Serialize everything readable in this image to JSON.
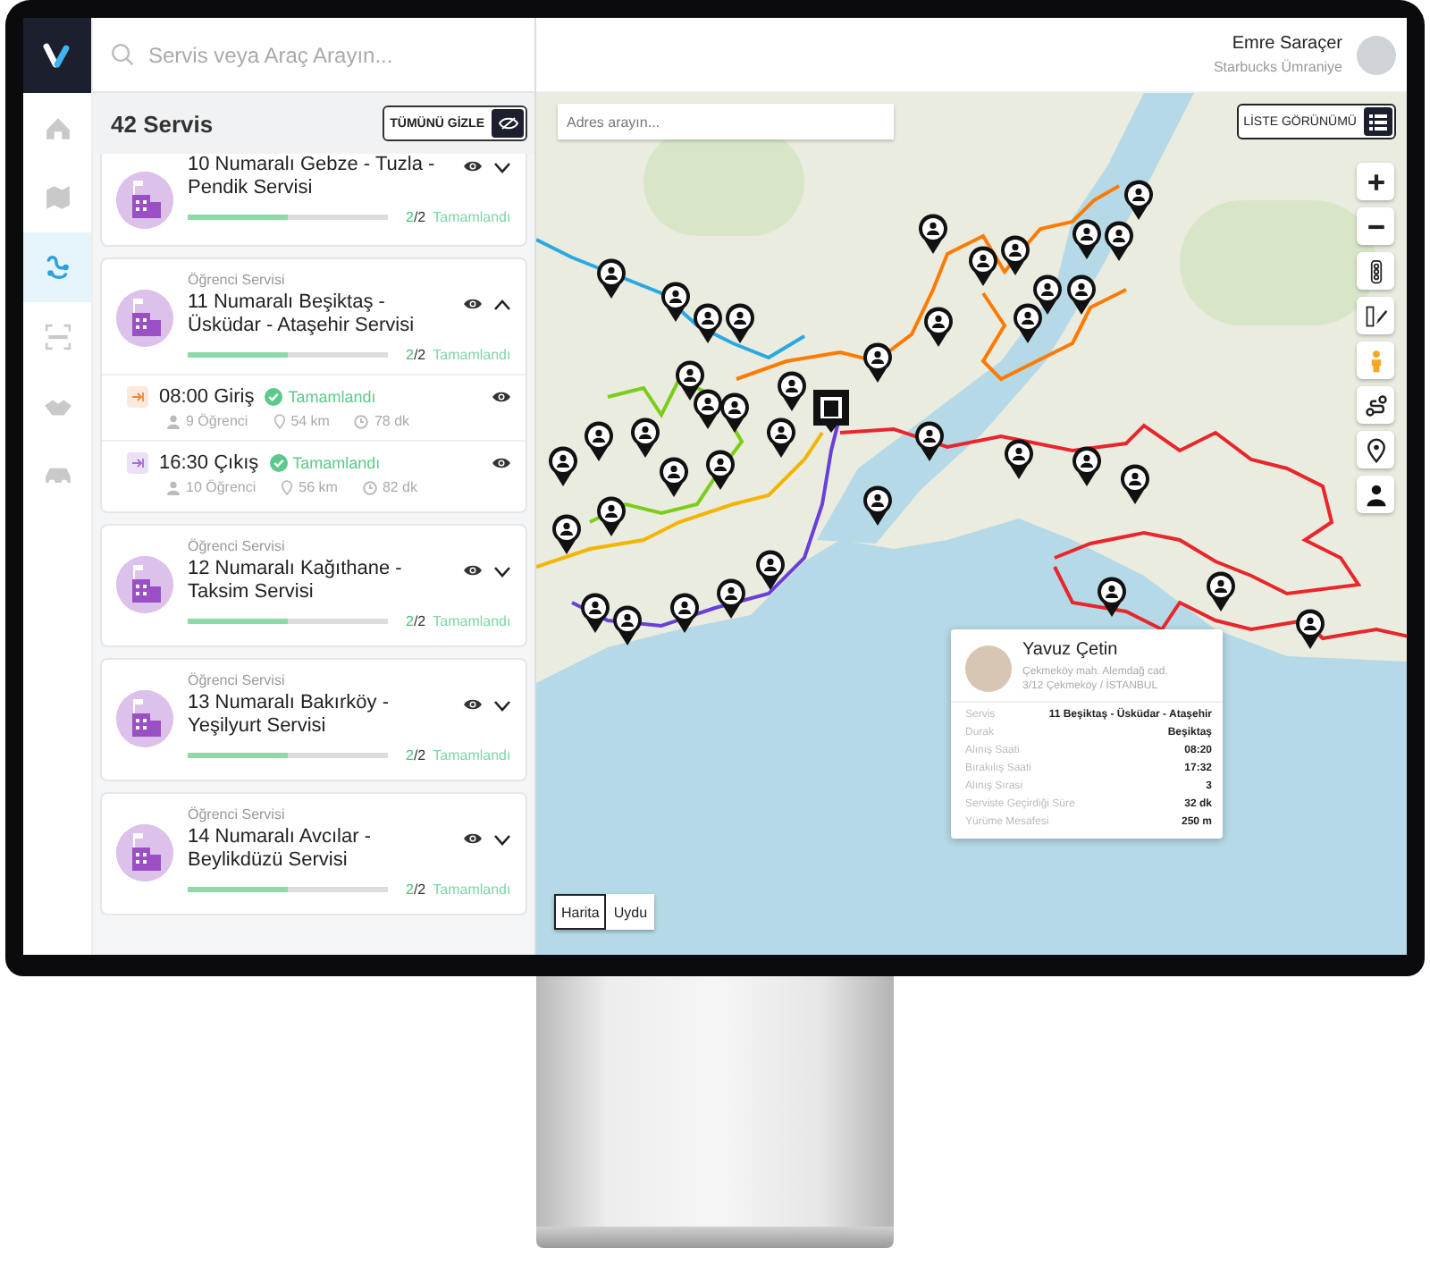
{
  "search": {
    "placeholder": "Servis veya Araç Arayın..."
  },
  "nav": [
    {
      "selected": false
    },
    {
      "selected": false
    },
    {
      "selected": true
    },
    {
      "selected": false
    },
    {
      "selected": false
    },
    {
      "selected": false
    }
  ],
  "panel": {
    "title": "42 Servis",
    "hide_all_button": "TÜMÜNÜ GİZLE",
    "services": [
      {
        "name": "10 Numaralı Gebze - Tuzla - Pendik Servisi",
        "level": 0.5,
        "done": "2",
        "total": "/2",
        "status": "Tamamlandı",
        "expanded": false
      },
      {
        "type": "Öğrenci Servisi",
        "name": "11 Numaralı Beşiktaş - Üsküdar - Ataşehir Servisi",
        "level": 0.5,
        "done": "2",
        "total": "/2",
        "status": "Tamamlandı",
        "expanded": true,
        "trips": [
          {
            "kind": "in",
            "time": "08:00 Giriş",
            "status": "Tamamlandı",
            "students": "9 Öğrenci",
            "distance": "54 km",
            "duration": "78 dk"
          },
          {
            "kind": "out",
            "time": "16:30 Çıkış",
            "status": "Tamamlandı",
            "students": "10 Öğrenci",
            "distance": "56 km",
            "duration": "82 dk"
          }
        ]
      },
      {
        "type": "Öğrenci Servisi",
        "name": "12 Numaralı Kağıthane - Taksim Servisi",
        "level": 0.5,
        "done": "2",
        "total": "/2",
        "status": "Tamamlandı",
        "expanded": false
      },
      {
        "type": "Öğrenci Servisi",
        "name": "13 Numaralı Bakırköy - Yeşilyurt Servisi",
        "level": 0.5,
        "done": "2",
        "total": "/2",
        "status": "Tamamlandı",
        "expanded": false
      },
      {
        "type": "Öğrenci Servisi",
        "name": "14 Numaralı Avcılar - Beylikdüzü Servisi",
        "level": 0.5,
        "done": "2",
        "total": "/2",
        "status": "Tamamlandı",
        "expanded": false
      }
    ]
  },
  "user": {
    "name": "Emre Saraçer",
    "company": "Starbucks Ümraniye"
  },
  "map": {
    "address_search": {
      "placeholder": "Adres arayın..."
    },
    "list_view_button": "LİSTE GÖRÜNÜMÜ",
    "map_types": [
      {
        "label": "Harita",
        "selected": true
      },
      {
        "label": "Uydu",
        "selected": false
      }
    ],
    "popup": {
      "name": "Yavuz Çetin",
      "address_lines": [
        "Çekmeköy mah. Alemdağ cad.",
        "3/12 Çekmeköy / İSTANBUL"
      ],
      "rows": [
        {
          "label": "Servis",
          "value": "11 Beşiktaş - Üsküdar - Ataşehir"
        },
        {
          "label": "Durak",
          "value": "Beşiktaş"
        },
        {
          "label": "Alınış Saati",
          "value": "08:20"
        },
        {
          "label": "Bırakılış Saati",
          "value": "17:32"
        },
        {
          "label": "Alınış Sırası",
          "value": "3"
        },
        {
          "label": "Serviste Geçirdiği Süre",
          "value": "32 dk"
        },
        {
          "label": "Yürüme Mesafesi",
          "value": "250 m"
        }
      ]
    }
  }
}
